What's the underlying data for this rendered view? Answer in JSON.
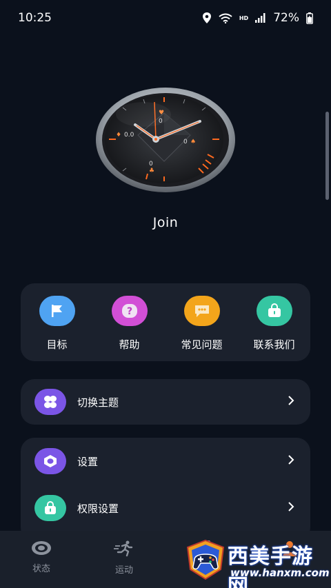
{
  "status_bar": {
    "time": "10:25",
    "network": "HD",
    "battery": "72%",
    "icons": [
      "location-icon",
      "wifi-icon",
      "signal-icon",
      "battery-icon"
    ]
  },
  "device": {
    "name": "Join",
    "watch_face": {
      "readouts": [
        "0",
        "0.0",
        "0",
        "0"
      ],
      "accent_color": "#ff6a1f"
    }
  },
  "quick_actions": [
    {
      "label": "目标",
      "icon": "flag-icon",
      "color": "#4fa3f2"
    },
    {
      "label": "帮助",
      "icon": "question-icon",
      "color": "#d24fd6"
    },
    {
      "label": "常见问题",
      "icon": "chat-icon",
      "color": "#f3a51b"
    },
    {
      "label": "联系我们",
      "icon": "bag-icon",
      "color": "#35c6a2"
    }
  ],
  "menu": {
    "theme": {
      "label": "切换主题",
      "icon": "theme-icon",
      "color": "#7b55e6"
    },
    "settings": {
      "label": "设置",
      "icon": "settings-icon",
      "color": "#7b55e6"
    },
    "permissions": {
      "label": "权限设置",
      "icon": "lock-icon",
      "color": "#35c6a2"
    }
  },
  "bottom_nav": [
    {
      "label": "状态",
      "icon": "status-icon"
    },
    {
      "label": "运动",
      "icon": "run-icon"
    },
    {
      "label": "",
      "icon": "watch-icon"
    },
    {
      "label": "",
      "icon": "profile-icon"
    }
  ],
  "watermark": {
    "title": "西美手游网",
    "url": "www.hanxm.com"
  },
  "colors": {
    "background": "#0b111c",
    "card": "#1b212d",
    "nav": "#1a202b",
    "brand_blue": "#2b5ad6"
  }
}
